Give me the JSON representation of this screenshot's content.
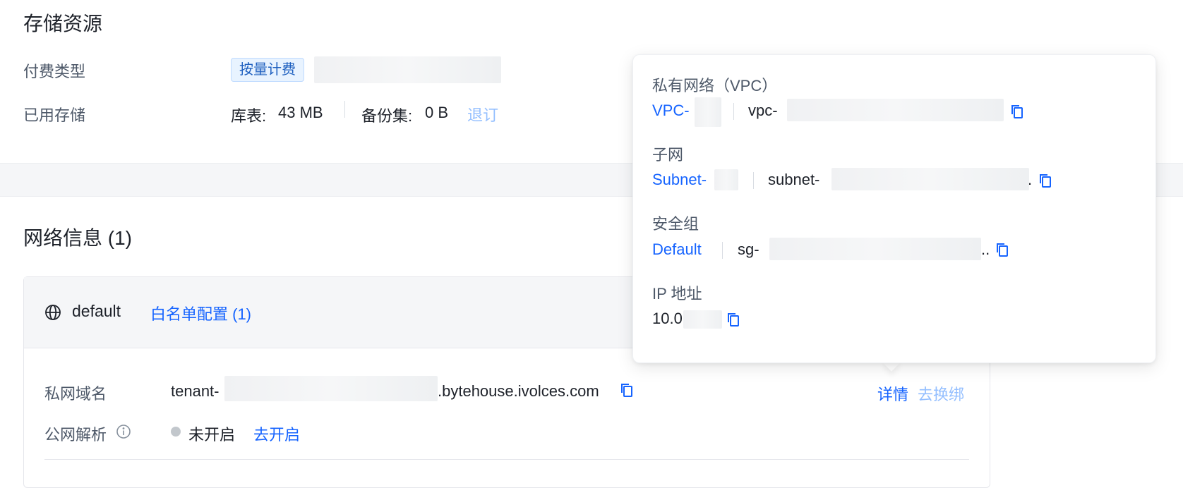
{
  "storage": {
    "title": "存储资源",
    "billing_label": "付费类型",
    "billing_tag": "按量计费",
    "used_label": "已用存储",
    "tables_label": "库表:",
    "tables_value": "43 MB",
    "backup_label": "备份集:",
    "backup_value": "0 B",
    "unsubscribe_link": "退订"
  },
  "network": {
    "title": "网络信息 (1)",
    "card": {
      "name": "default",
      "whitelist_link": "白名单配置 (1)",
      "private_domain_label": "私网域名",
      "private_domain_prefix": "tenant-",
      "private_domain_suffix": ".bytehouse.ivolces.com",
      "details_link": "详情",
      "rebind_link": "去换绑",
      "public_dns_label": "公网解析",
      "public_dns_status": "未开启",
      "enable_link": "去开启"
    }
  },
  "popover": {
    "vpc_title": "私有网络（VPC）",
    "vpc_name": "VPC-",
    "vpc_id": "vpc-",
    "subnet_title": "子网",
    "subnet_name": "Subnet-",
    "subnet_id": "subnet-",
    "subnet_id_tail": ".",
    "sg_title": "安全组",
    "sg_name": "Default",
    "sg_id": "sg-",
    "sg_id_tail": "..",
    "ip_title": "IP 地址",
    "ip_value": "10.0"
  },
  "icons": {
    "copy": "copy-icon",
    "globe": "globe-icon",
    "info": "info-icon"
  },
  "colors": {
    "link": "#1664ff",
    "link_light": "#94bfff",
    "tag_bg": "#e8f3ff",
    "status_dot": "#c2c7cc"
  }
}
